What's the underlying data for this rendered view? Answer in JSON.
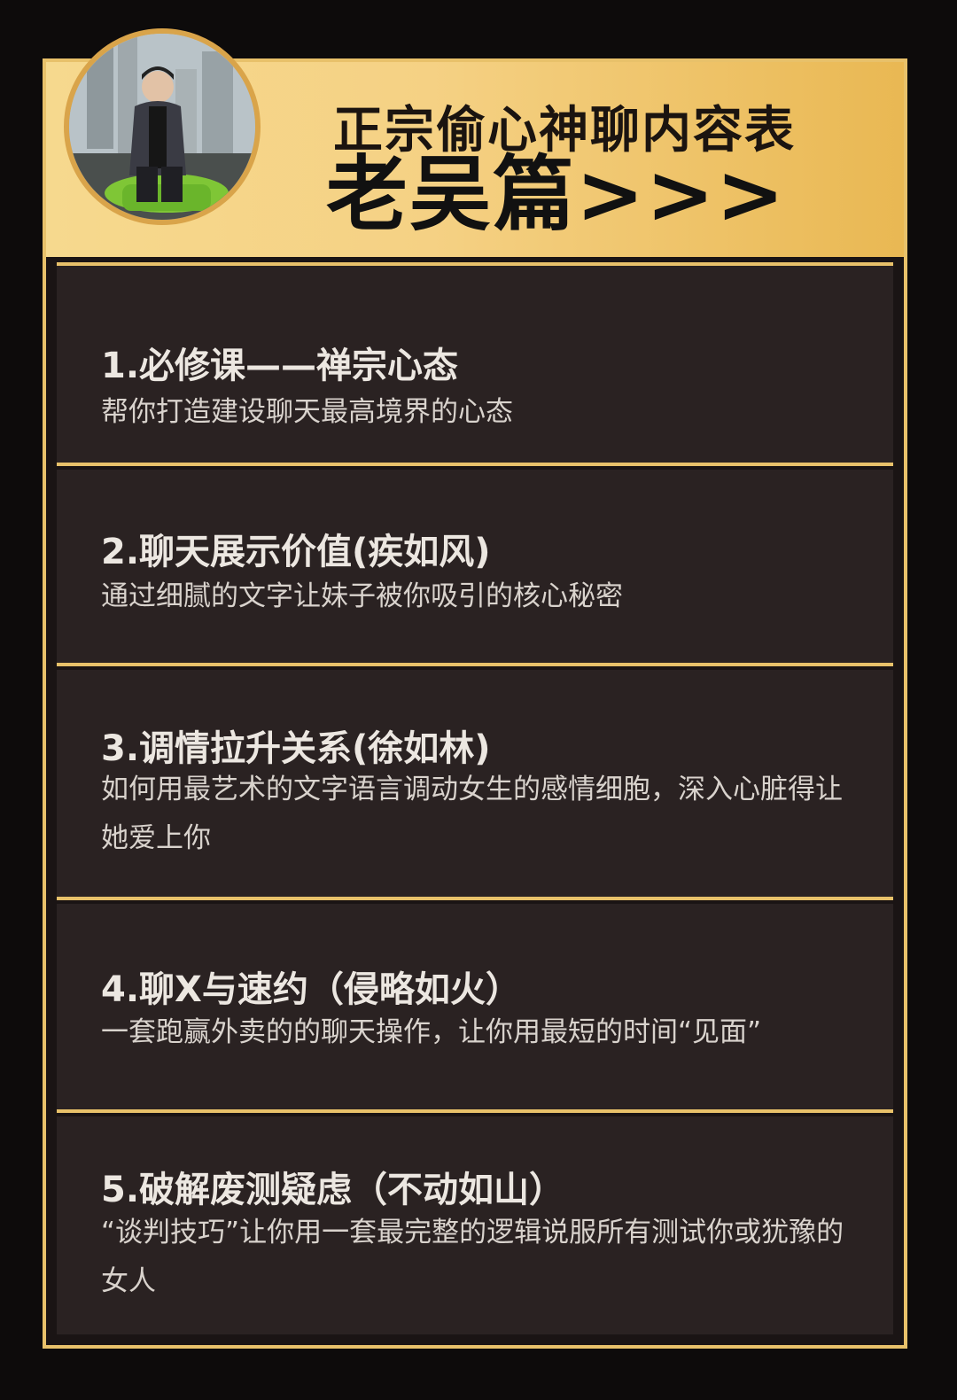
{
  "header": {
    "title": "正宗偷心神聊内容表",
    "subtitle": "老吴篇>>>"
  },
  "items": [
    {
      "heading": "1.必修课——禅宗心态",
      "desc": "帮你打造建设聊天最高境界的心态"
    },
    {
      "heading": "2.聊天展示价值(疾如风)",
      "desc": "通过细腻的文字让妹子被你吸引的核心秘密"
    },
    {
      "heading": "3.调情拉升关系(徐如林)",
      "desc": "如何用最艺术的文字语言调动女生的感情细胞，深入心脏得让她爱上你"
    },
    {
      "heading": "4.聊X与速约（侵略如火）",
      "desc": "一套跑赢外卖的的聊天操作，让你用最短的时间“见面”"
    },
    {
      "heading": "5.破解废测疑虑（不动如山）",
      "desc": "“谈判技巧”让你用一套最完整的逻辑说服所有测试你或犹豫的女人"
    }
  ],
  "colors": {
    "gold": "#e8c16a",
    "card": "#2a2222",
    "background": "#0d0b0b"
  }
}
